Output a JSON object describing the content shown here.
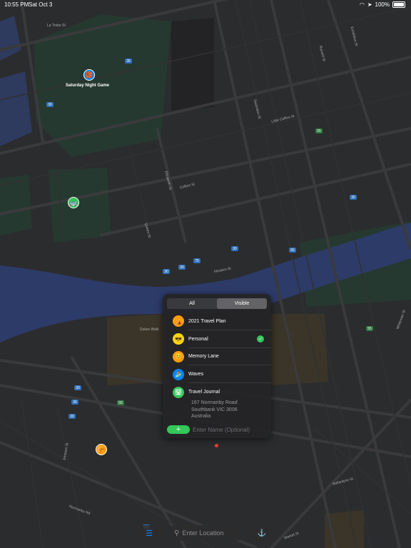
{
  "status_bar": {
    "time": "10:55 PM",
    "date": "Sat Oct 3",
    "battery": "100%"
  },
  "map": {
    "street_labels": [
      "La Trobe St",
      "Collins St",
      "Flinders St",
      "Whiteman St",
      "Dukes Walk",
      "Ballantyne St",
      "Normanby Rd",
      "Johnson St",
      "Market St",
      "Little Collins St",
      "Queen St",
      "Elizabeth St",
      "Swanston St",
      "Russell St",
      "Exhibition St"
    ],
    "route_shields": [
      "35",
      "30",
      "55",
      "30",
      "30",
      "75",
      "65",
      "30",
      "30",
      "55",
      "30",
      "30",
      "30",
      "30",
      "55"
    ],
    "pins": [
      {
        "label": "Saturday Night Game",
        "color": "#0a84ff",
        "emoji": "🏀"
      },
      {
        "label": "",
        "color": "#34c759",
        "emoji": "🚌"
      },
      {
        "label": "",
        "color": "#ff9f0a",
        "emoji": "🥐"
      }
    ]
  },
  "collection_panel": {
    "segment": {
      "all_label": "All",
      "visible_label": "Visible"
    },
    "items": [
      {
        "label": "2021 Travel Plan",
        "color": "#ff9f0a",
        "emoji": "⛺",
        "checked": false
      },
      {
        "label": "Personal",
        "color": "#ffd60a",
        "emoji": "😎",
        "checked": true
      },
      {
        "label": "Memory Lane",
        "color": "#ff9f0a",
        "emoji": "😊",
        "checked": false
      },
      {
        "label": "Waves",
        "color": "#0a84ff",
        "emoji": "🏄",
        "checked": false
      },
      {
        "label": "Travel Journal",
        "color": "#34c759",
        "emoji": "🛣",
        "checked": false
      }
    ],
    "address": {
      "line1": "167 Normanby Road",
      "line2": "Southbank VIC 3006",
      "line3": "Australia"
    },
    "add_label": "+",
    "name_placeholder": "Enter Name (Optional)"
  },
  "toolbar": {
    "search_placeholder": "Enter Location",
    "list_icon": "list-icon",
    "location_icon": "location-icon"
  }
}
